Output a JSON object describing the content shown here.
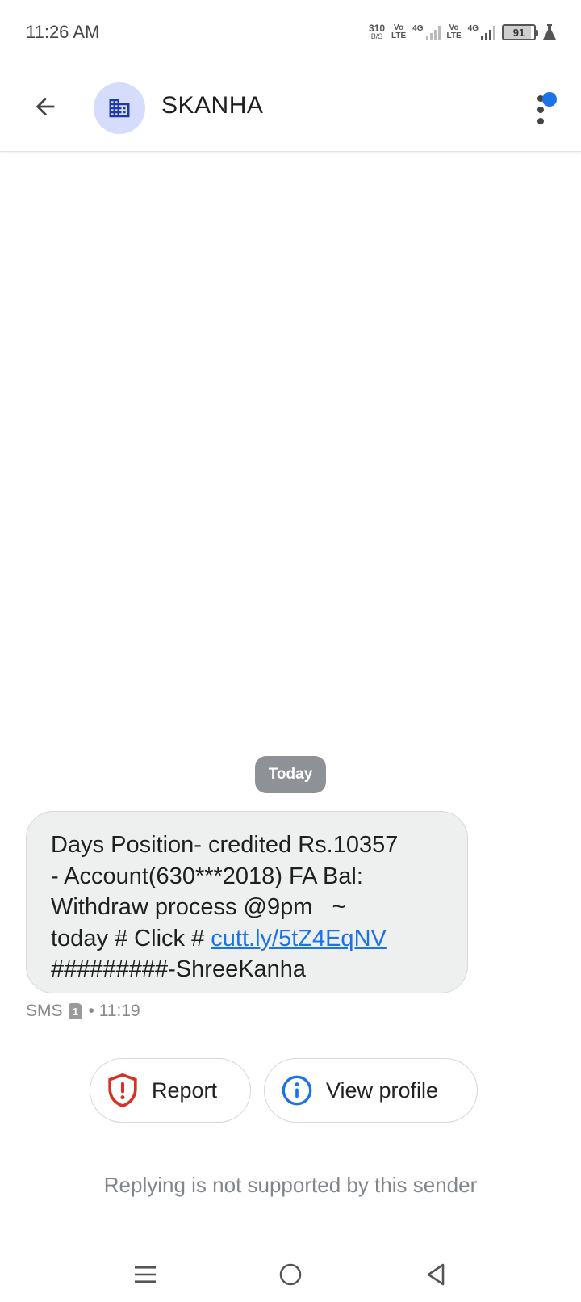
{
  "status_bar": {
    "time": "11:26 AM",
    "net_speed_value": "310",
    "net_speed_unit": "B/S",
    "sim1_volte_top": "Vo",
    "sim1_volte_bottom": "LTE",
    "sim1_network": "4G",
    "sim2_volte_top": "Vo",
    "sim2_volte_bottom": "LTE",
    "sim2_network": "4G",
    "battery_level": "91"
  },
  "header": {
    "contact_name": "SKANHA",
    "icons": {
      "back": "arrow-back-icon",
      "avatar": "business-building-icon",
      "more": "more-vert-icon"
    },
    "accent_color": "#1a73e8",
    "avatar_bg": "#d6dcfb"
  },
  "conversation": {
    "date_label": "Today",
    "message": {
      "line1": "Days Position- credited Rs.10357",
      "line2": "- Account(630***2018) FA Bal:",
      "line3": "Withdraw process @9pm   ~",
      "line4_prefix": "today # Click # ",
      "link": "cutt.ly/5tZ4EqNV",
      "line5": "#########-ShreeKanha"
    },
    "meta_channel": "SMS",
    "meta_sim": "1",
    "meta_time": "• 11:19"
  },
  "actions": {
    "report_label": "Report",
    "view_profile_label": "View profile",
    "report_color": "#d93025",
    "info_color": "#1a73e8"
  },
  "footer": {
    "reply_note": "Replying is not supported by this sender"
  },
  "nav_bar": {
    "icons": [
      "menu-icon",
      "home-icon",
      "back-triangle-icon"
    ]
  }
}
